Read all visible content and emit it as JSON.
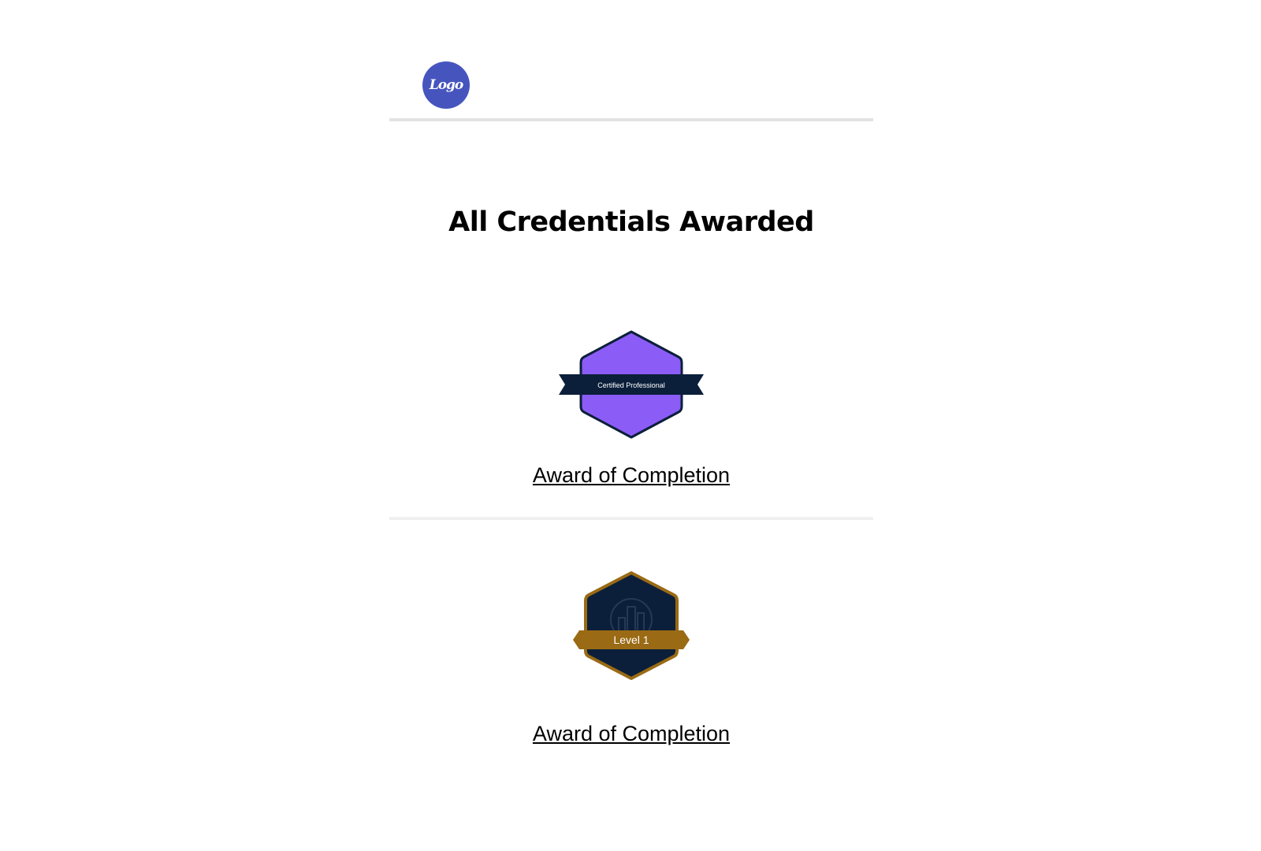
{
  "header": {
    "logo_text": "Logo"
  },
  "page": {
    "title": "All Credentials Awarded"
  },
  "credentials": [
    {
      "badge_text": "Certified Professional",
      "badge_color": "#8b5cf6",
      "badge_outline": "#0b1f3a",
      "link_label": "Award of Completion"
    },
    {
      "badge_text": "Level 1",
      "badge_color": "#0b1f3a",
      "badge_outline": "#9a6a14",
      "link_label": "Award of Completion"
    }
  ]
}
